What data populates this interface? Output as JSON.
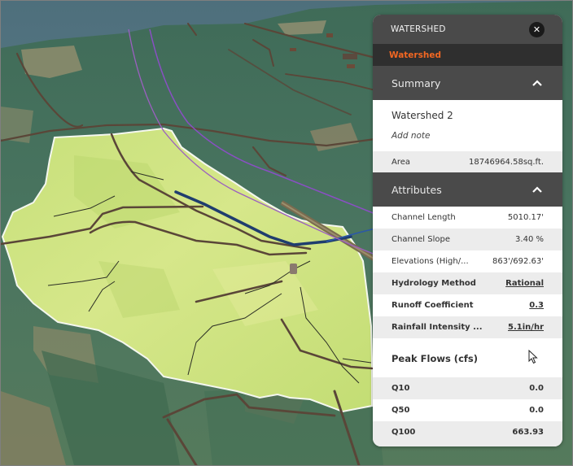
{
  "panel": {
    "header_title": "WATERSHED",
    "close_icon": "close-icon",
    "active_tab": "Watershed",
    "colors": {
      "accent": "#f26722",
      "header_bg": "#4a4a4a",
      "tab_bg": "#2f2f2f",
      "row_alt": "#ececec"
    },
    "summary": {
      "label": "Summary",
      "expanded": true,
      "name": "Watershed 2",
      "add_note_label": "Add note",
      "area": {
        "label": "Area",
        "value": "18746964.58sq.ft."
      }
    },
    "attributes": {
      "label": "Attributes",
      "expanded": true,
      "rows": [
        {
          "label": "Channel Length",
          "value": "5010.17'"
        },
        {
          "label": "Channel Slope",
          "value": "3.40 %"
        },
        {
          "label": "Elevations (High/...",
          "value": "863'/692.63'"
        }
      ],
      "editable_rows": [
        {
          "label": "Hydrology Method",
          "value": "Rational"
        },
        {
          "label": "Runoff Coefficient",
          "value": "0.3"
        },
        {
          "label": "Rainfall Intensity ...",
          "value": "5.1in/hr"
        }
      ]
    },
    "peak_flows": {
      "label": "Peak Flows (cfs)",
      "rows": [
        {
          "label": "Q10",
          "value": "0.0"
        },
        {
          "label": "Q50",
          "value": "0.0"
        },
        {
          "label": "Q100",
          "value": "663.93"
        }
      ]
    }
  }
}
